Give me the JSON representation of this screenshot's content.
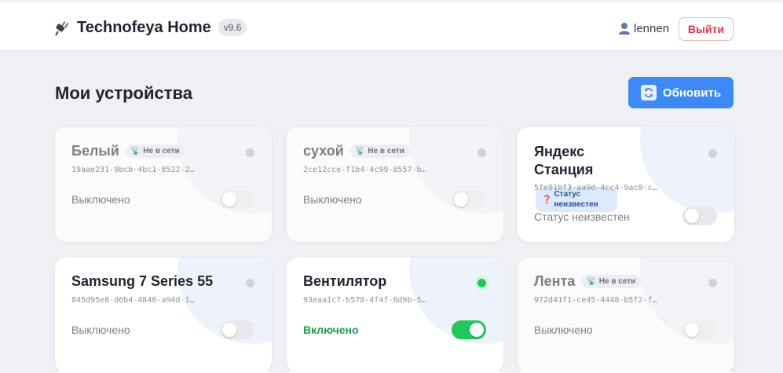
{
  "header": {
    "brand": "Technofeya Home",
    "version": "v9.6",
    "username": "lennen",
    "logout_label": "Выйти"
  },
  "main": {
    "title": "Мои устройства",
    "refresh_label": "Обновить"
  },
  "devices": [
    {
      "name": "Белый",
      "badge": "Не в сети",
      "id": "19aae231-9bcb-4bc1-8522-2…",
      "state": "Выключено"
    },
    {
      "name": "сухой",
      "badge": "Не в сети",
      "id": "2ce12cce-f1b4-4c99-8557-b…",
      "state": "Выключено"
    },
    {
      "name": "Яндекс Станция",
      "badge": "Статус неизвестен",
      "id": "5fe91bf3-aa9d-4cc4-9ac0-c…",
      "state": "Статус неизвестен"
    },
    {
      "name": "Samsung 7 Series 55",
      "badge": "",
      "id": "845d95e8-d6b4-4840-a94d-1…",
      "state": "Выключено"
    },
    {
      "name": "Вентилятор",
      "badge": "",
      "id": "93eaa1c7-b578-4f4f-8d9b-5…",
      "state": "Включено"
    },
    {
      "name": "Лента",
      "badge": "Не в сети",
      "id": "972d41f1-ce45-4448-b5f2-f…",
      "state": "Выключено"
    }
  ],
  "colors": {
    "accent": "#3d8af7",
    "online": "#22c55e",
    "logout": "#e0344a"
  }
}
